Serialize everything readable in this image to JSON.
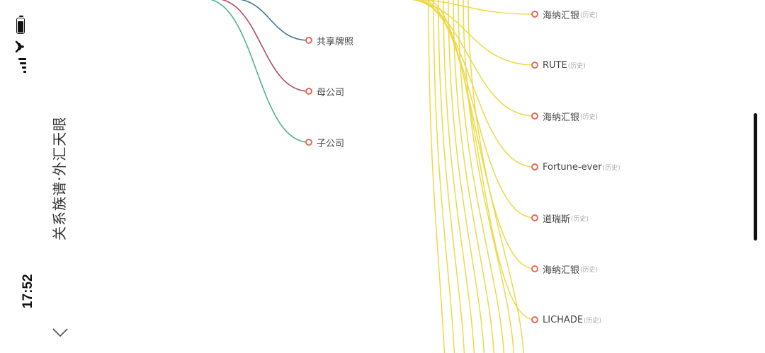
{
  "status_bar": {
    "time": "17:52",
    "icons": [
      "battery-icon",
      "wifi-icon",
      "signal-icon"
    ]
  },
  "header": {
    "title": "关系族谱·外汇天眼",
    "back_icon": "chevron-down-icon"
  },
  "colors": {
    "link_share_license": "#3e7a92",
    "link_parent": "#b24d5e",
    "link_subsidiary": "#53b38a",
    "link_history": "#ecd948",
    "node_dot": "#e46a5a"
  },
  "relation_nodes": [
    {
      "label": "共享牌照"
    },
    {
      "label": "母公司"
    },
    {
      "label": "子公司"
    }
  ],
  "history_nodes": [
    {
      "label": "海纳汇银",
      "tag": "(历史)"
    },
    {
      "label": "RUTE",
      "tag": "(历史)"
    },
    {
      "label": "海纳汇银",
      "tag": "(历史)"
    },
    {
      "label": "Fortune-ever",
      "tag": "(历史)"
    },
    {
      "label": "道瑞斯",
      "tag": "(历史)"
    },
    {
      "label": " 海纳汇银",
      "tag": "(历史)"
    },
    {
      "label": "LICHADE",
      "tag": "(历史)"
    }
  ]
}
